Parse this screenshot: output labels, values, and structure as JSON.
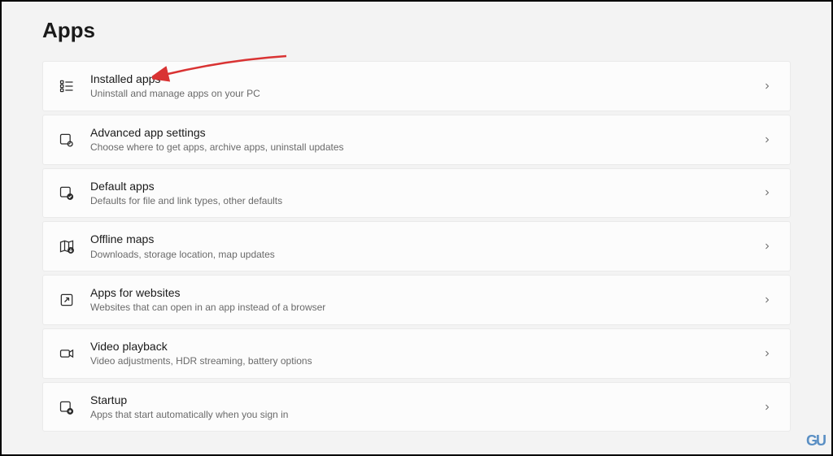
{
  "page": {
    "title": "Apps"
  },
  "items": [
    {
      "title": "Installed apps",
      "description": "Uninstall and manage apps on your PC"
    },
    {
      "title": "Advanced app settings",
      "description": "Choose where to get apps, archive apps, uninstall updates"
    },
    {
      "title": "Default apps",
      "description": "Defaults for file and link types, other defaults"
    },
    {
      "title": "Offline maps",
      "description": "Downloads, storage location, map updates"
    },
    {
      "title": "Apps for websites",
      "description": "Websites that can open in an app instead of a browser"
    },
    {
      "title": "Video playback",
      "description": "Video adjustments, HDR streaming, battery options"
    },
    {
      "title": "Startup",
      "description": "Apps that start automatically when you sign in"
    }
  ]
}
